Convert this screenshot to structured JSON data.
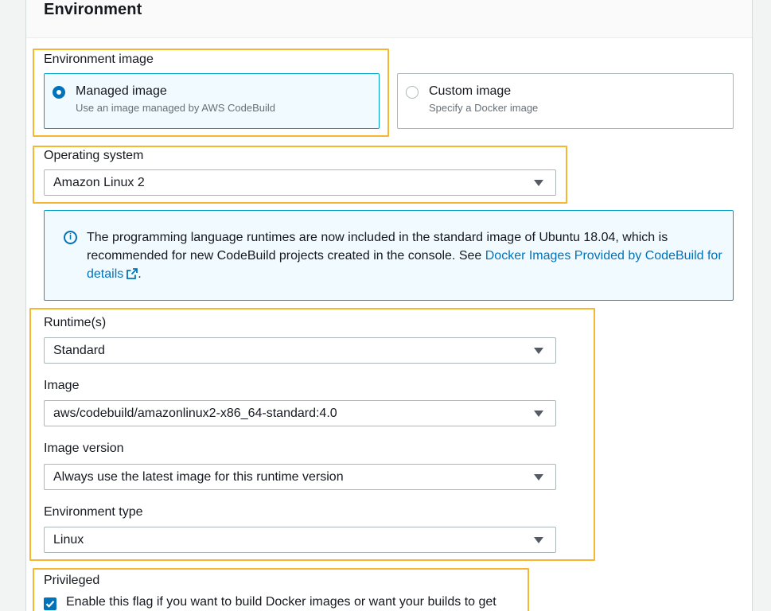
{
  "section": {
    "title": "Environment"
  },
  "environment_image": {
    "label": "Environment image",
    "options": [
      {
        "title": "Managed image",
        "description": "Use an image managed by AWS CodeBuild",
        "selected": true
      },
      {
        "title": "Custom image",
        "description": "Specify a Docker image",
        "selected": false
      }
    ]
  },
  "operating_system": {
    "label": "Operating system",
    "value": "Amazon Linux 2"
  },
  "info_alert": {
    "text_before": "The programming language runtimes are now included in the standard image of Ubuntu 18.04, which is recommended for new CodeBuild projects created in the console. See ",
    "link_text": "Docker Images Provided by CodeBuild for details",
    "text_after": "."
  },
  "runtime": {
    "label": "Runtime(s)",
    "value": "Standard"
  },
  "image": {
    "label": "Image",
    "value": "aws/codebuild/amazonlinux2-x86_64-standard:4.0"
  },
  "image_version": {
    "label": "Image version",
    "value": "Always use the latest image for this runtime version"
  },
  "environment_type": {
    "label": "Environment type",
    "value": "Linux"
  },
  "privileged": {
    "label": "Privileged",
    "checkbox_label": "Enable this flag if you want to build Docker images or want your builds to get",
    "checked": true
  },
  "colors": {
    "highlight": "#f5b731",
    "accent": "#0073bb",
    "info_border": "#00a1c9"
  }
}
